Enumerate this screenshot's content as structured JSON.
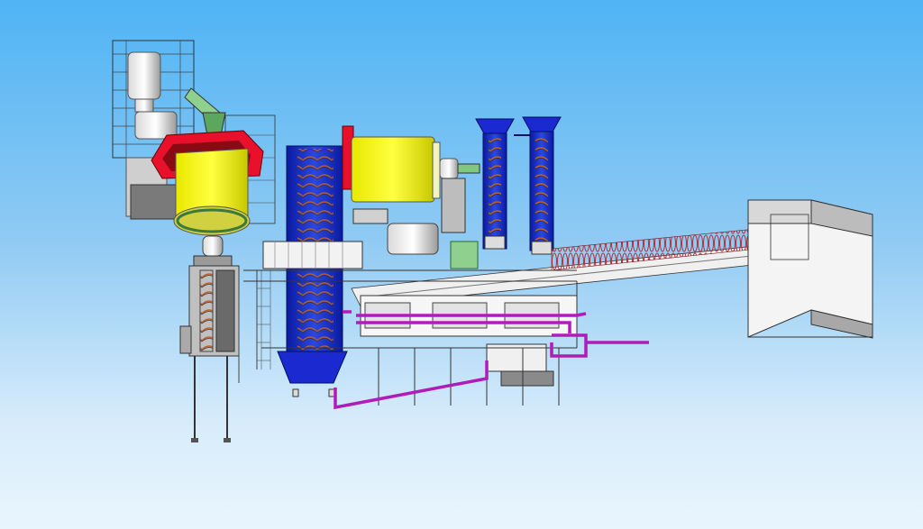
{
  "scene": {
    "description_free": true,
    "colors": {
      "sky_top": "#4fb4f5",
      "sky_bottom": "#e9f5fd",
      "mill_yellow": "#f0f000",
      "mill_red": "#e8102a",
      "classifier_blue": "#1230c0",
      "structure_grey": "#8a8f94",
      "pipe_magenta": "#b01cb8",
      "motor_green": "#6cc47a",
      "building_white": "#f4f4f4"
    },
    "components": [
      "hoist-tower",
      "grinding-mill-left",
      "grinding-mill-upper",
      "spiral-classifier-main",
      "cyclone-column-1",
      "cyclone-column-2",
      "inclined-conveyor",
      "receiving-building",
      "flotation-cells",
      "slurry-pipes",
      "support-frames"
    ]
  }
}
